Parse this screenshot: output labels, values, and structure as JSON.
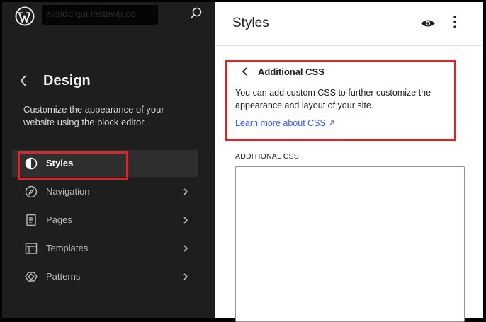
{
  "sidebar": {
    "site_url": "alisiddiqui.instawp.co",
    "title": "Design",
    "description": "Customize the appearance of your website using the block editor.",
    "items": [
      {
        "label": "Styles",
        "icon": "contrast-icon",
        "active": true
      },
      {
        "label": "Navigation",
        "icon": "compass-icon"
      },
      {
        "label": "Pages",
        "icon": "page-icon"
      },
      {
        "label": "Templates",
        "icon": "layout-icon"
      },
      {
        "label": "Patterns",
        "icon": "diamond-icon"
      }
    ]
  },
  "panel": {
    "title": "Styles",
    "section_title": "Additional CSS",
    "description": "You can add custom CSS to further customize the appearance and layout of your site.",
    "learn_more": "Learn more about CSS",
    "field_label": "ADDITIONAL CSS",
    "field_value": ""
  },
  "colors": {
    "sidebar_bg": "#1e1e1e",
    "annotation_red": "#d9262b",
    "link_blue": "#3858e9"
  }
}
